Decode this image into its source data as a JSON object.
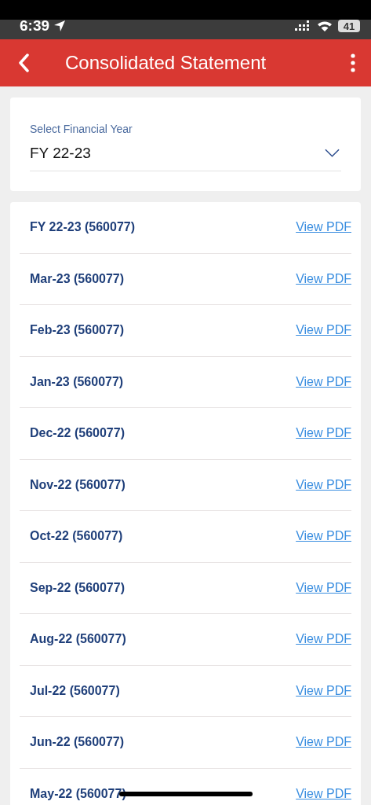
{
  "status_bar": {
    "time": "6:39",
    "battery": "41"
  },
  "header": {
    "title": "Consolidated Statement"
  },
  "year_select": {
    "label": "Select Financial Year",
    "value": "FY 22-23"
  },
  "statements": [
    {
      "period": "FY 22-23 (560077)",
      "link": "View PDF"
    },
    {
      "period": "Mar-23 (560077)",
      "link": "View PDF"
    },
    {
      "period": "Feb-23 (560077)",
      "link": "View PDF"
    },
    {
      "period": "Jan-23 (560077)",
      "link": "View PDF"
    },
    {
      "period": "Dec-22 (560077)",
      "link": "View PDF"
    },
    {
      "period": "Nov-22 (560077)",
      "link": "View PDF"
    },
    {
      "period": "Oct-22 (560077)",
      "link": "View PDF"
    },
    {
      "period": "Sep-22 (560077)",
      "link": "View PDF"
    },
    {
      "period": "Aug-22 (560077)",
      "link": "View PDF"
    },
    {
      "period": "Jul-22 (560077)",
      "link": "View PDF"
    },
    {
      "period": "Jun-22 (560077)",
      "link": "View PDF"
    },
    {
      "period": "May-22 (560077)",
      "link": "View PDF"
    }
  ]
}
